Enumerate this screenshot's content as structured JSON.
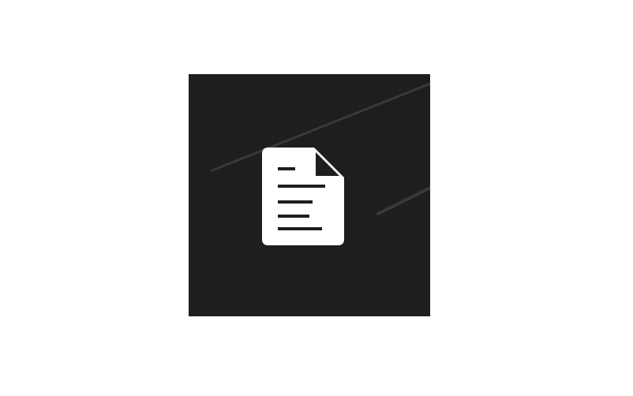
{
  "tile": {
    "background_color": "#1f1e1f",
    "icon": "document-icon",
    "icon_color": "#ffffff",
    "label": ""
  }
}
